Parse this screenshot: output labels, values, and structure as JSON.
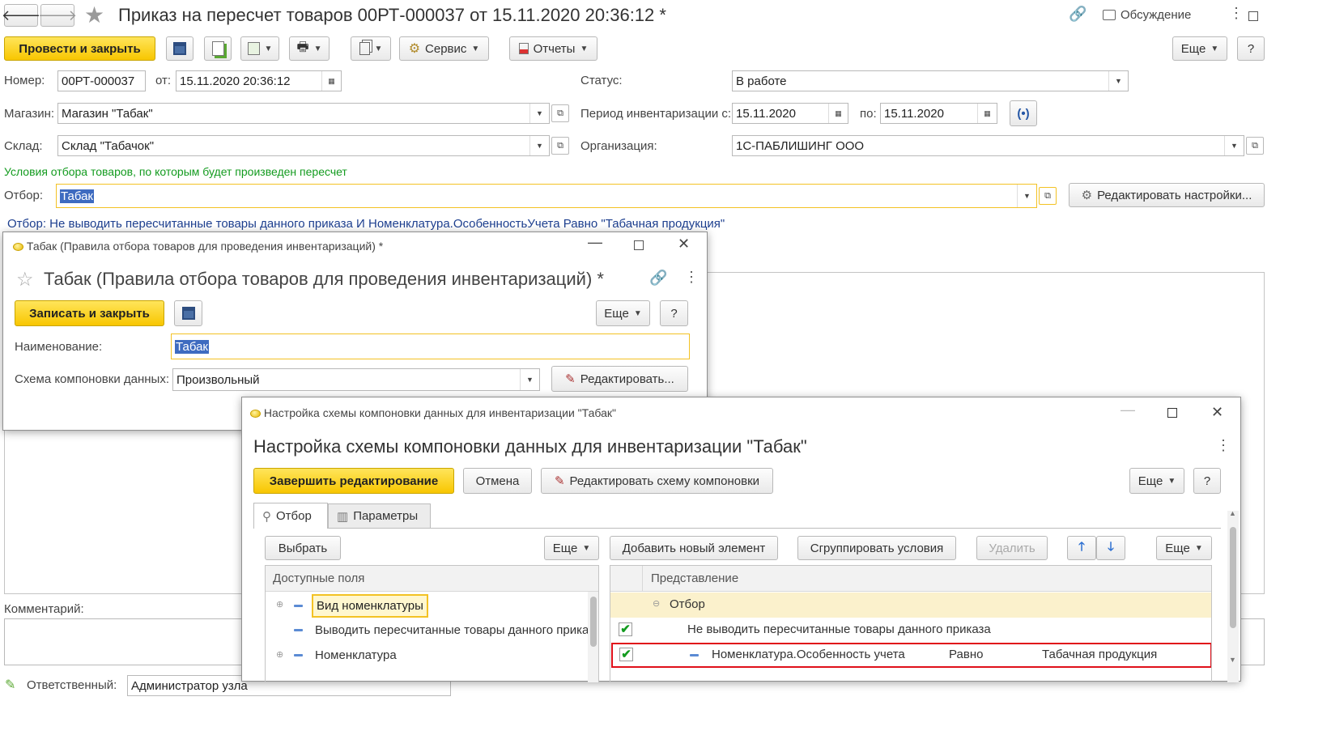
{
  "main": {
    "title": "Приказ на пересчет товаров 00РТ-000037 от 15.11.2020 20:36:12 *",
    "discuss": "Обсуждение",
    "toolbar": {
      "post_close": "Провести и закрыть",
      "service": "Сервис",
      "reports": "Отчеты",
      "more": "Еще",
      "help": "?"
    },
    "fields": {
      "number_label": "Номер:",
      "number": "00РТ-000037",
      "date_label": "от:",
      "date": "15.11.2020 20:36:12",
      "status_label": "Статус:",
      "status": "В работе",
      "store_label": "Магазин:",
      "store": "Магазин \"Табак\"",
      "period_label": "Период инвентаризации с:",
      "period_from": "15.11.2020",
      "period_to_label": "по:",
      "period_to": "15.11.2020",
      "warehouse_label": "Склад:",
      "warehouse": "Склад \"Табачок\"",
      "org_label": "Организация:",
      "org": "1С-ПАБЛИШИНГ ООО",
      "conditions_title": "Условия отбора товаров, по которым будет произведен пересчет",
      "filter_label": "Отбор:",
      "filter": "Табак",
      "edit_settings": "Редактировать настройки...",
      "filter_desc": "Отбор: Не выводить пересчитанные товары данного приказа И Номенклатура.ОсобенностьУчета Равно \"Табачная продукция\"",
      "comment_label": "Комментарий:",
      "responsible_label": "Ответственный:",
      "responsible": "Администратор узла"
    }
  },
  "rule_window": {
    "window_title": "Табак (Правила отбора товаров для проведения инвентаризаций) *",
    "heading": "Табак (Правила отбора товаров для проведения инвентаризаций) *",
    "save_close": "Записать и закрыть",
    "more": "Еще",
    "help": "?",
    "name_label": "Наименование:",
    "name": "Табак",
    "scheme_label": "Схема компоновки данных:",
    "scheme": "Произвольный",
    "edit": "Редактировать..."
  },
  "settings_window": {
    "window_title": "Настройка схемы компоновки данных для инвентаризации \"Табак\"",
    "heading": "Настройка схемы компоновки данных для инвентаризации \"Табак\"",
    "finish": "Завершить редактирование",
    "cancel": "Отмена",
    "edit_scheme": "Редактировать схему компоновки",
    "more": "Еще",
    "help": "?",
    "tabs": [
      "Отбор",
      "Параметры"
    ],
    "left": {
      "select": "Выбрать",
      "more": "Еще",
      "header": "Доступные поля",
      "items": [
        "Вид номенклатуры",
        "Выводить пересчитанные товары данного прика",
        "Номенклатура"
      ]
    },
    "right": {
      "add": "Добавить новый элемент",
      "group": "Сгруппировать условия",
      "delete": "Удалить",
      "more": "Еще",
      "header": "Представление",
      "group_row": "Отбор",
      "row1": "Не выводить пересчитанные товары данного приказа",
      "row2": {
        "field": "Номенклатура.Особенность учета",
        "cond": "Равно",
        "value": "Табачная продукция"
      }
    }
  },
  "colors": {
    "accent": "#f8c600",
    "filter_text": "#1d3f8f",
    "green_title": "#139b1f",
    "highlight_border": "#e0101a"
  }
}
